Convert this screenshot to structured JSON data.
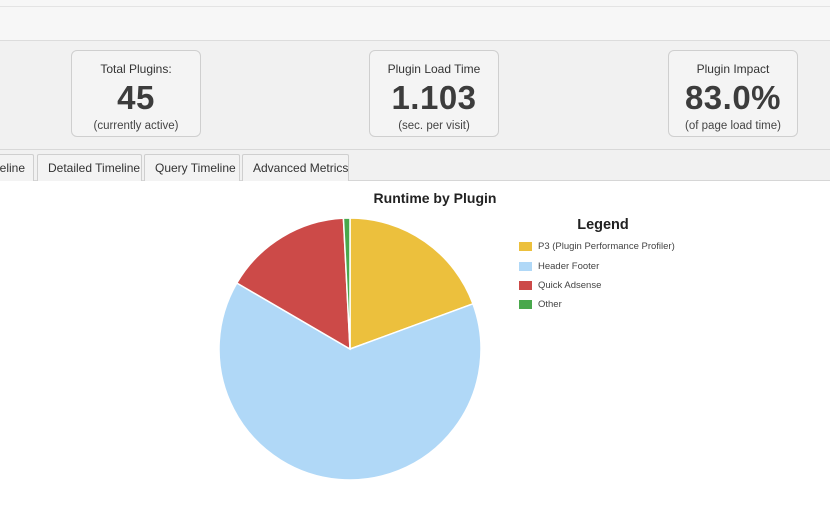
{
  "stats": [
    {
      "label": "Total Plugins:",
      "value": "45",
      "sub": "(currently active)"
    },
    {
      "label": "Plugin Load Time",
      "value": "1.103",
      "sub": "(sec. per visit)"
    },
    {
      "label": "Plugin Impact",
      "value": "83.0%",
      "sub": "(of page load time)"
    }
  ],
  "tabs": [
    {
      "label": "eline"
    },
    {
      "label": "Detailed Timeline"
    },
    {
      "label": "Query Timeline"
    },
    {
      "label": "Advanced Metrics"
    }
  ],
  "chart": {
    "title": "Runtime by Plugin",
    "legend_title": "Legend"
  },
  "chart_data": {
    "type": "pie",
    "title": "Runtime by Plugin",
    "legend_placement": "right",
    "categories": [
      "P3 (Plugin Performance Profiler)",
      "Header Footer",
      "Quick Adsense",
      "Other"
    ],
    "values": [
      19.4,
      64.0,
      15.8,
      0.8
    ],
    "colors": [
      "#ecc03d",
      "#b0d8f7",
      "#cc4a48",
      "#49a84c"
    ]
  }
}
